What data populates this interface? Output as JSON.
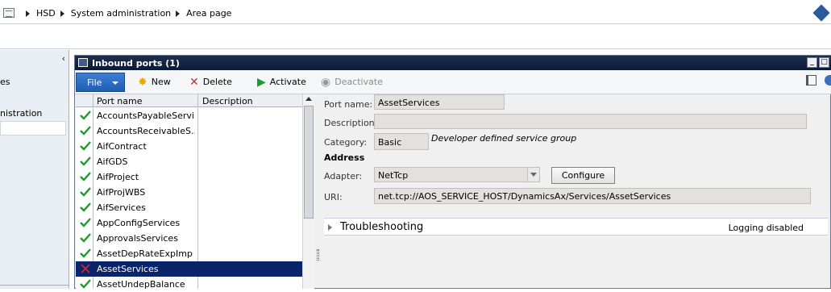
{
  "address": {
    "crumbs": [
      "HSD",
      "System administration",
      "Area page"
    ]
  },
  "nav": {
    "items": [
      {
        "label": "es"
      },
      {
        "label": "nistration"
      }
    ]
  },
  "window": {
    "title": "Inbound ports (1)"
  },
  "actions": {
    "file": "File",
    "new": "New",
    "delete": "Delete",
    "activate": "Activate",
    "deactivate": "Deactivate"
  },
  "grid": {
    "columns": [
      "Port name",
      "Description"
    ],
    "rows": [
      {
        "name": "AccountsPayableServi...",
        "status": "active"
      },
      {
        "name": "AccountsReceivableS...",
        "status": "active"
      },
      {
        "name": "AifContract",
        "status": "active"
      },
      {
        "name": "AifGDS",
        "status": "active"
      },
      {
        "name": "AifProject",
        "status": "active"
      },
      {
        "name": "AifProjWBS",
        "status": "active"
      },
      {
        "name": "AifServices",
        "status": "active"
      },
      {
        "name": "AppConfigServices",
        "status": "active"
      },
      {
        "name": "ApprovalsServices",
        "status": "active"
      },
      {
        "name": "AssetDepRateExpImp",
        "status": "active"
      },
      {
        "name": "AssetServices",
        "status": "inactive",
        "selected": true
      },
      {
        "name": "AssetUndepBalance",
        "status": "active"
      }
    ]
  },
  "details": {
    "port_name_label": "Port name:",
    "port_name": "AssetServices",
    "description_label": "Description:",
    "description": "",
    "category_label": "Category:",
    "category": "Basic",
    "category_note": "Developer defined service group",
    "address_group": "Address",
    "adapter_label": "Adapter:",
    "adapter": "NetTcp",
    "configure": "Configure",
    "uri_label": "URI:",
    "uri": "net.tcp://AOS_SERVICE_HOST/DynamicsAx/Services/AssetServices",
    "fasttab_title": "Troubleshooting",
    "fasttab_summary": "Logging disabled"
  },
  "colors": {
    "titlebar": "#0b1a36",
    "file_button": "#1e5fb5",
    "selected_row": "#0a246a",
    "check_green": "#1f9a2c",
    "x_red": "#d12a2a"
  }
}
